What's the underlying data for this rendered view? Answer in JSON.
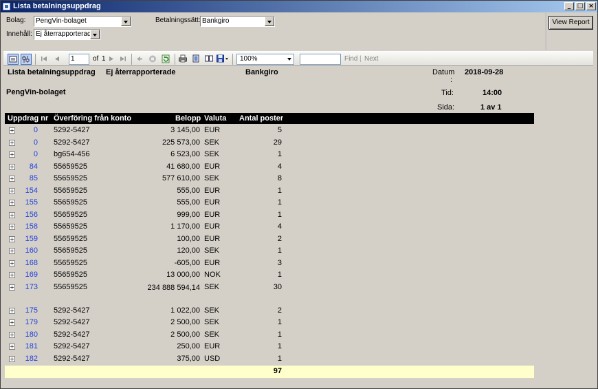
{
  "window": {
    "title": "Lista betalningsuppdrag"
  },
  "params": {
    "bolag_label": "Bolag:",
    "bolag_value": "PengVin-bolaget",
    "innehall_label": "Innehåll:",
    "innehall_value": "Ej återrapporterade",
    "betalningssatt_label": "Betalningssätt:",
    "betalningssatt_value": "Bankgiro",
    "view_report": "View Report"
  },
  "toolbar": {
    "page_value": "1",
    "of_label": "of",
    "total_pages": "1",
    "zoom": "100%",
    "find": "Find",
    "next": "Next"
  },
  "report": {
    "title": "Lista betalningsuppdrag",
    "filter_content": "Ej återrapporterade",
    "filter_method": "Bankgiro",
    "company": "PengVin-bolaget",
    "datum_label": "Datum",
    "datum_colon": ":",
    "datum_value": "2018-09-28",
    "tid_label": "Tid:",
    "tid_value": "14:00",
    "sida_label": "Sida:",
    "sida_value": "1 av 1",
    "columns": {
      "uppdrag": "Uppdrag nr",
      "konto": "Överföring från konto",
      "belopp": "Belopp",
      "valuta": "Valuta",
      "poster": "Antal poster"
    },
    "rows": [
      {
        "nr": "0",
        "konto": "5292-5427",
        "belopp": "3 145,00",
        "valuta": "EUR",
        "poster": "5"
      },
      {
        "nr": "0",
        "konto": "5292-5427",
        "belopp": "225 573,00",
        "valuta": "SEK",
        "poster": "29"
      },
      {
        "nr": "0",
        "konto": "bg654-456",
        "belopp": "6 523,00",
        "valuta": "SEK",
        "poster": "1"
      },
      {
        "nr": "84",
        "konto": "55659525",
        "belopp": "41 680,00",
        "valuta": "EUR",
        "poster": "4"
      },
      {
        "nr": "85",
        "konto": "55659525",
        "belopp": "577 610,00",
        "valuta": "SEK",
        "poster": "8"
      },
      {
        "nr": "154",
        "konto": "55659525",
        "belopp": "555,00",
        "valuta": "EUR",
        "poster": "1"
      },
      {
        "nr": "155",
        "konto": "55659525",
        "belopp": "555,00",
        "valuta": "EUR",
        "poster": "1"
      },
      {
        "nr": "156",
        "konto": "55659525",
        "belopp": "999,00",
        "valuta": "EUR",
        "poster": "1"
      },
      {
        "nr": "158",
        "konto": "55659525",
        "belopp": "1 170,00",
        "valuta": "EUR",
        "poster": "4"
      },
      {
        "nr": "159",
        "konto": "55659525",
        "belopp": "100,00",
        "valuta": "EUR",
        "poster": "2"
      },
      {
        "nr": "160",
        "konto": "55659525",
        "belopp": "120,00",
        "valuta": "SEK",
        "poster": "1"
      },
      {
        "nr": "168",
        "konto": "55659525",
        "belopp": "-605,00",
        "valuta": "EUR",
        "poster": "3"
      },
      {
        "nr": "169",
        "konto": "55659525",
        "belopp": "13 000,00",
        "valuta": "NOK",
        "poster": "1"
      },
      {
        "nr": "173",
        "konto": "55659525",
        "belopp": "234 888 594,14",
        "valuta": "SEK",
        "poster": "30"
      },
      {
        "nr": "175",
        "konto": "5292-5427",
        "belopp": "1 022,00",
        "valuta": "SEK",
        "poster": "2"
      },
      {
        "nr": "179",
        "konto": "5292-5427",
        "belopp": "2 500,00",
        "valuta": "SEK",
        "poster": "1"
      },
      {
        "nr": "180",
        "konto": "5292-5427",
        "belopp": "2 500,00",
        "valuta": "SEK",
        "poster": "1"
      },
      {
        "nr": "181",
        "konto": "5292-5427",
        "belopp": "250,00",
        "valuta": "EUR",
        "poster": "1"
      },
      {
        "nr": "182",
        "konto": "5292-5427",
        "belopp": "375,00",
        "valuta": "USD",
        "poster": "1"
      }
    ],
    "total_poster": "97"
  }
}
